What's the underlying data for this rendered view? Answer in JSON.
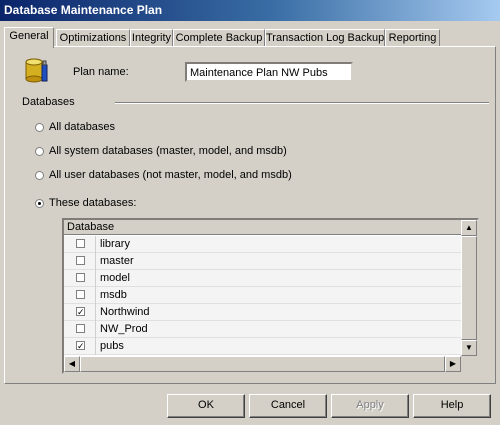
{
  "window": {
    "title": "Database Maintenance Plan"
  },
  "tabs": [
    {
      "label": "General"
    },
    {
      "label": "Optimizations"
    },
    {
      "label": "Integrity"
    },
    {
      "label": "Complete Backup"
    },
    {
      "label": "Transaction Log Backup"
    },
    {
      "label": "Reporting"
    }
  ],
  "general": {
    "plan_name_label": "Plan name:",
    "plan_name_value": "Maintenance Plan NW Pubs",
    "databases_group_label": "Databases",
    "radios": [
      {
        "label": "All databases",
        "checked": false
      },
      {
        "label": "All system databases (master, model, and msdb)",
        "checked": false
      },
      {
        "label": "All user databases (not master, model, and msdb)",
        "checked": false
      },
      {
        "label": "These databases:",
        "checked": true
      }
    ],
    "grid": {
      "header": "Database",
      "rows": [
        {
          "name": "library",
          "checked": false
        },
        {
          "name": "master",
          "checked": false
        },
        {
          "name": "model",
          "checked": false
        },
        {
          "name": "msdb",
          "checked": false
        },
        {
          "name": "Northwind",
          "checked": true
        },
        {
          "name": "NW_Prod",
          "checked": false
        },
        {
          "name": "pubs",
          "checked": true
        }
      ]
    }
  },
  "buttons": {
    "ok": "OK",
    "cancel": "Cancel",
    "apply": "Apply",
    "help": "Help"
  }
}
